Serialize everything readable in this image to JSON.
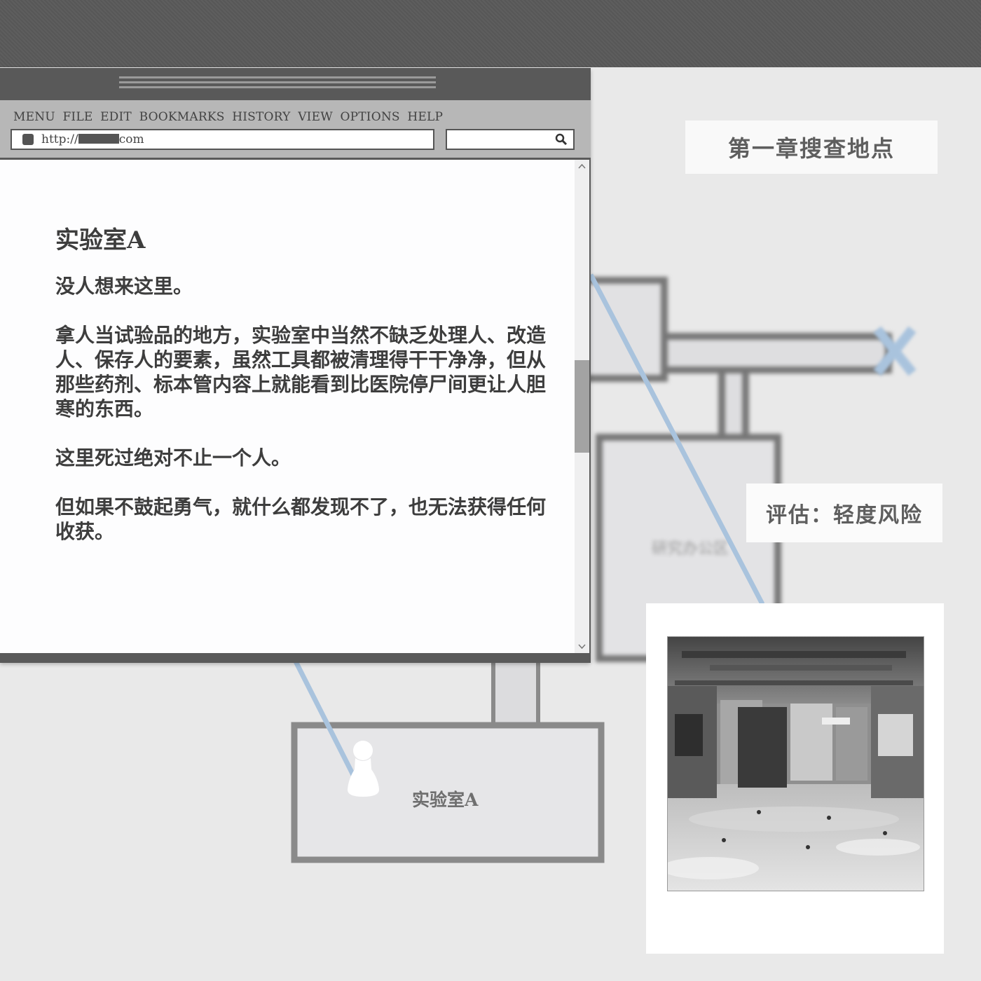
{
  "browser": {
    "menu": [
      "MENU",
      "FILE",
      "EDIT",
      "BOOKMARKS",
      "HISTORY",
      "VIEW",
      "OPTIONS",
      "HELP"
    ],
    "url_prefix": "http://",
    "url_suffix": "com"
  },
  "article": {
    "title": "实验室A",
    "paragraphs": [
      "没人想来这里。",
      "拿人当试验品的地方，实验室中当然不缺乏处理人、改造人、保存人的要素，虽然工具都被清理得干干净净，但从那些药剂、标本管内容上就能看到比医院停尸间更让人胆寒的东西。",
      "这里死过绝对不止一个人。",
      "但如果不鼓起勇气，就什么都发现不了，也无法获得任何收获。"
    ]
  },
  "chapter_label": "第一章搜查地点",
  "assessment_label": "评估：轻度风险",
  "map": {
    "current_room": "实验室A",
    "path_color": "#a9c3dd",
    "marker_color": "#a9c3dd"
  },
  "icons": [
    "search-icon",
    "pawn-icon",
    "x-marker-icon",
    "scroll-up-icon",
    "scroll-down-icon",
    "favicon-icon"
  ]
}
